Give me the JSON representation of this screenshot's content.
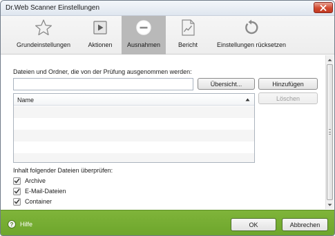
{
  "window": {
    "title": "Dr.Web Scanner Einstellungen"
  },
  "toolbar": {
    "items": [
      {
        "label": "Grundeinstellungen",
        "icon": "star-icon"
      },
      {
        "label": "Aktionen",
        "icon": "play-icon"
      },
      {
        "label": "Ausnahmen",
        "icon": "minus-circle-icon",
        "active": true
      },
      {
        "label": "Bericht",
        "icon": "report-chart-icon"
      },
      {
        "label": "Einstellungen rücksetzen",
        "icon": "reset-icon"
      }
    ]
  },
  "exclusions": {
    "heading": "Dateien und Ordner, die von der Prüfung ausgenommen werden:",
    "path_value": "",
    "browse_label": "Übersicht...",
    "add_label": "Hinzufügen",
    "delete_label": "Löschen",
    "list": {
      "column_name": "Name",
      "rows": []
    }
  },
  "content_check": {
    "heading": "Inhalt folgender Dateien überprüfen:",
    "options": [
      {
        "label": "Archive",
        "checked": true
      },
      {
        "label": "E-Mail-Dateien",
        "checked": true
      },
      {
        "label": "Container",
        "checked": true
      }
    ]
  },
  "footer": {
    "help_label": "Hilfe",
    "ok_label": "OK",
    "cancel_label": "Abbrechen"
  },
  "colors": {
    "footer_green": "#76ad33",
    "active_tab": "#b9b9b9",
    "close_red": "#d1492f"
  }
}
